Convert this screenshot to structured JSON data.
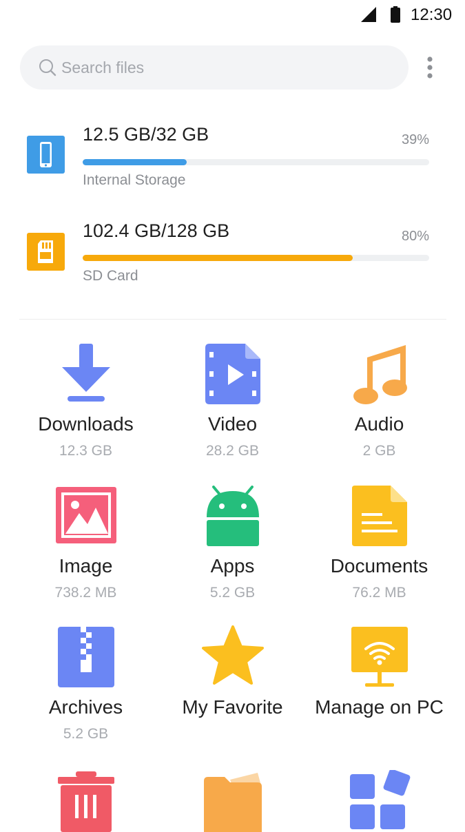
{
  "status_bar": {
    "time": "12:30"
  },
  "search": {
    "placeholder": "Search files"
  },
  "storage": [
    {
      "size": "12.5 GB/32 GB",
      "percent_label": "39%",
      "fraction": 0.3,
      "label": "Internal Storage",
      "color": "#3f9ce6"
    },
    {
      "size": "102.4 GB/128 GB",
      "percent_label": "80%",
      "fraction": 0.78,
      "label": "SD Card",
      "color": "#f7a90b"
    }
  ],
  "categories": [
    {
      "name": "Downloads",
      "size": "12.3 GB",
      "icon": "download-icon"
    },
    {
      "name": "Video",
      "size": "28.2 GB",
      "icon": "video-icon"
    },
    {
      "name": "Audio",
      "size": "2 GB",
      "icon": "music-note-icon"
    },
    {
      "name": "Image",
      "size": "738.2 MB",
      "icon": "image-icon"
    },
    {
      "name": "Apps",
      "size": "5.2 GB",
      "icon": "android-icon"
    },
    {
      "name": "Documents",
      "size": "76.2 MB",
      "icon": "document-icon"
    },
    {
      "name": "Archives",
      "size": "5.2 GB",
      "icon": "archive-zip-icon"
    },
    {
      "name": "My Favorite",
      "size": "",
      "icon": "star-icon"
    },
    {
      "name": "Manage on PC",
      "size": "",
      "icon": "wifi-monitor-icon"
    },
    {
      "name": "",
      "size": "",
      "icon": "trash-icon"
    },
    {
      "name": "",
      "size": "",
      "icon": "folder-icon"
    },
    {
      "name": "",
      "size": "",
      "icon": "app-grid-icon"
    }
  ],
  "colors": {
    "blue": "#6b86f4",
    "orange": "#f7a94a",
    "pink": "#f55f7b",
    "green": "#25be7c",
    "yellow": "#fbbf1f",
    "red": "#f05a66",
    "internal_bar": "#3f9ce6",
    "sd_bar": "#f7a90b"
  }
}
